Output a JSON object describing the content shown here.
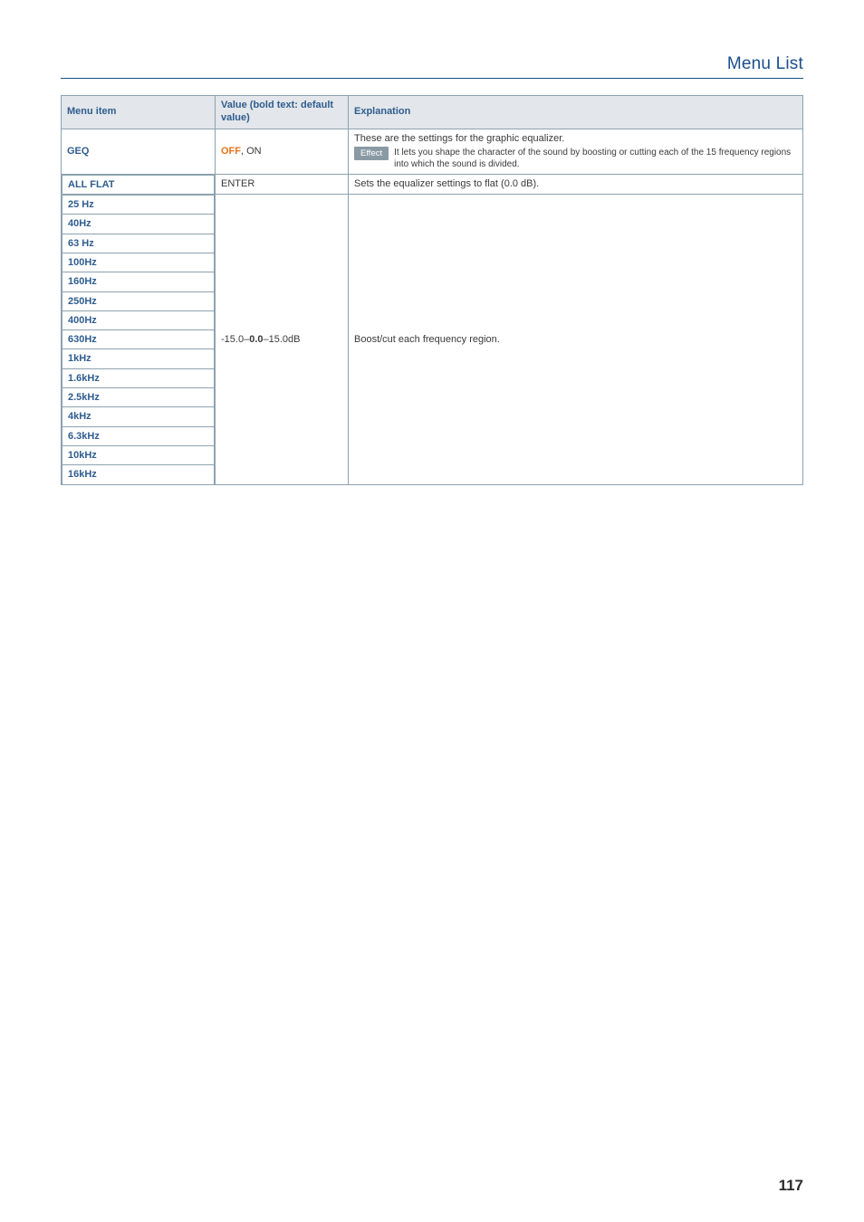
{
  "header": {
    "title": "Menu List"
  },
  "columns": {
    "menu_item": "Menu item",
    "value": "Value (bold text: default value)",
    "explanation": "Explanation"
  },
  "rows": {
    "geq": {
      "label": "GEQ",
      "value_default": "OFF",
      "value_sep": ", ",
      "value_other": "ON",
      "explanation_line1": "These are the settings for the graphic equalizer.",
      "effect_badge": "Effect",
      "effect_text": "It lets you shape the character of the sound by boosting or cutting each of the 15 frequency regions into which the sound is divided."
    },
    "all_flat": {
      "label": "ALL FLAT",
      "value": "ENTER",
      "explanation": "Sets the equalizer settings to flat (0.0 dB)."
    },
    "freq": {
      "labels": [
        "25 Hz",
        "40Hz",
        "63 Hz",
        "100Hz",
        "160Hz",
        "250Hz",
        "400Hz",
        "630Hz",
        "1kHz",
        "1.6kHz",
        "2.5kHz",
        "4kHz",
        "6.3kHz",
        "10kHz",
        "16kHz"
      ],
      "value_pre": "-15.0–",
      "value_default": "0.0",
      "value_post": "–15.0dB",
      "explanation": "Boost/cut each frequency region."
    }
  },
  "page_number": "117"
}
